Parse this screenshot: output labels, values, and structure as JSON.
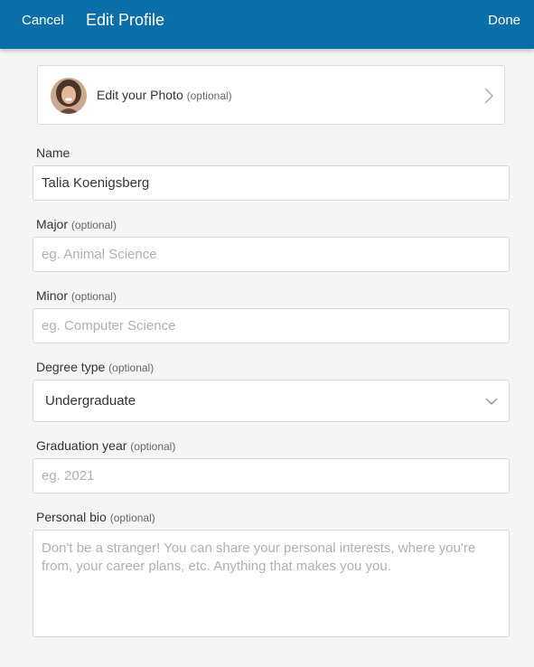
{
  "header": {
    "cancel_label": "Cancel",
    "title": "Edit Profile",
    "done_label": "Done",
    "background_color": "#0a6ea8"
  },
  "photo": {
    "label": "Edit your Photo",
    "optional": "(optional)",
    "avatar_icon": "profile-photo",
    "chevron_icon": "chevron-right-icon"
  },
  "fields": {
    "name": {
      "label": "Name",
      "value": "Talia Koenigsberg",
      "placeholder": ""
    },
    "major": {
      "label": "Major",
      "optional": "(optional)",
      "value": "",
      "placeholder": "eg. Animal Science"
    },
    "minor": {
      "label": "Minor",
      "optional": "(optional)",
      "value": "",
      "placeholder": "eg. Computer Science"
    },
    "degree": {
      "label": "Degree type",
      "optional": "(optional)",
      "selected": "Undergraduate",
      "chevron_icon": "chevron-down-icon"
    },
    "grad_year": {
      "label": "Graduation year",
      "optional": "(optional)",
      "value": "",
      "placeholder": "eg. 2021"
    },
    "bio": {
      "label": "Personal bio",
      "optional": "(optional)",
      "value": "",
      "placeholder": "Don't be a stranger! You can share your personal interests, where you're from, your career plans, etc. Anything that makes you you."
    }
  }
}
